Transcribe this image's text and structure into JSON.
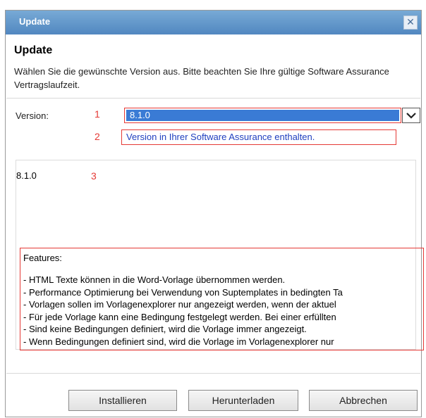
{
  "caption": "Update out of the dialog's title bar, the cut top text",
  "dialog": {
    "title": "Update",
    "close_icon": "close-x-icon",
    "heading": "Update",
    "description": "Wählen Sie die gewünschte Version aus. Bitte beachten Sie Ihre gültige Software Assurance Vertragslaufzeit."
  },
  "version": {
    "label": "Version:",
    "selected": "8.1.0",
    "note": "Version in Ihrer Software Assurance enthalten."
  },
  "markers": [
    "1",
    "2",
    "3"
  ],
  "details": {
    "version_text": "8.1.0",
    "features_title": "Features:",
    "features": [
      "- HTML Texte können in die Word-Vorlage übernommen werden.",
      "- Performance Optimierung bei Verwendung von Suptemplates in bedingten Ta",
      "- Vorlagen sollen im Vorlagenexplorer nur angezeigt werden, wenn der aktuel",
      "- Für jede Vorlage kann eine Bedingung festgelegt werden. Bei einer erfüllten",
      "- Sind keine Bedingungen definiert, wird die Vorlage immer angezeigt.",
      "- Wenn Bedingungen definiert sind, wird die Vorlage im Vorlagenexplorer nur"
    ]
  },
  "buttons": {
    "install": "Installieren",
    "download": "Herunterladen",
    "cancel": "Abbrechen"
  },
  "colors": {
    "titlebar": "#5f93c9",
    "selection": "#3a7bd5",
    "marker": "#e53935",
    "note_text": "#1f3fbf"
  }
}
